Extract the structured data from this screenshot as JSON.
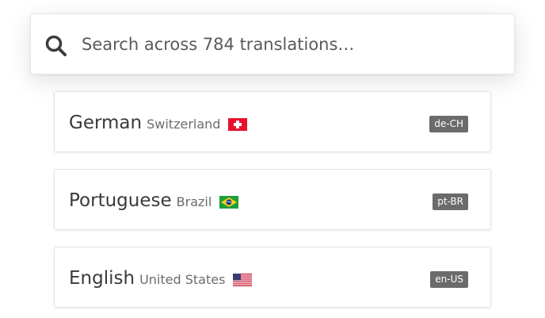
{
  "search": {
    "placeholder": "Search across 784 translations…",
    "icon": "search-icon"
  },
  "results": [
    {
      "language": "German",
      "region": "Switzerland",
      "flag_icon": "flag-ch-icon",
      "code": "de-CH"
    },
    {
      "language": "Portuguese",
      "region": "Brazil",
      "flag_icon": "flag-br-icon",
      "code": "pt-BR"
    },
    {
      "language": "English",
      "region": "United States",
      "flag_icon": "flag-us-icon",
      "code": "en-US"
    }
  ],
  "colors": {
    "badge": "#6b6b6b",
    "text": "#3a3a3a",
    "secondary_text": "#6b6b6b"
  }
}
